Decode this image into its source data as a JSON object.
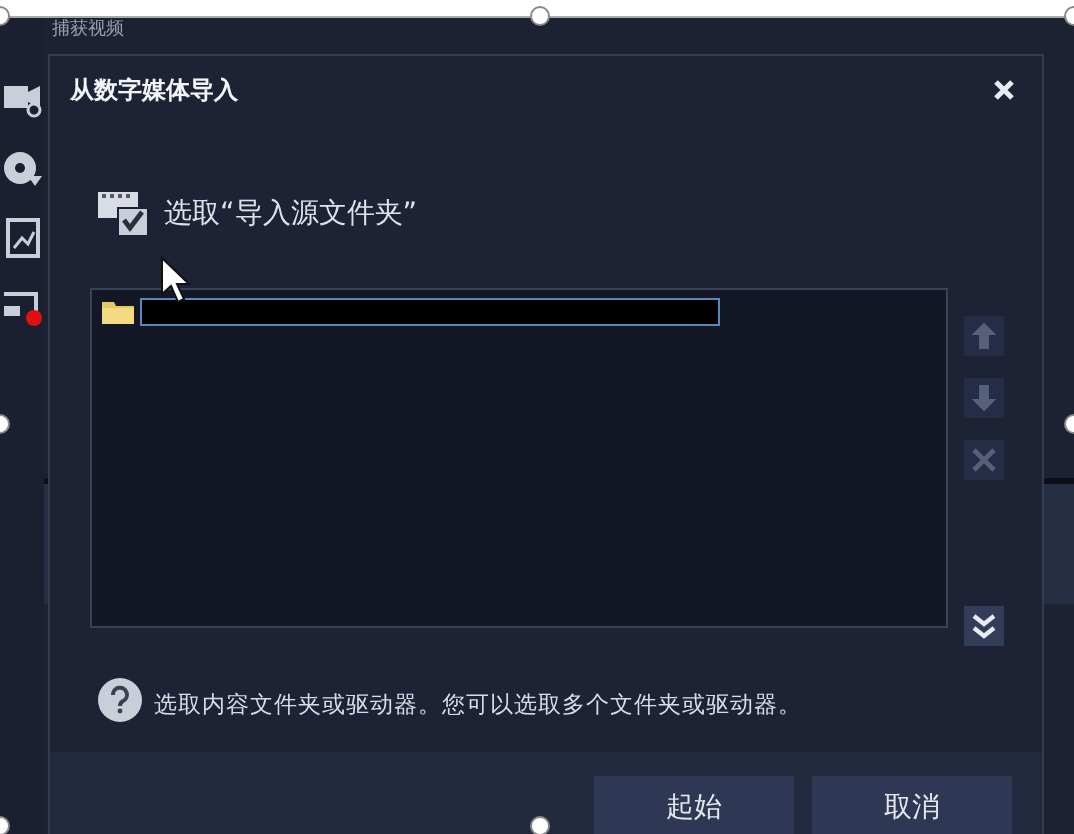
{
  "app": {
    "caption": "捕获视频"
  },
  "dialog": {
    "title": "从数字媒体导入",
    "heading": "选取“导入源文件夹”",
    "folders": [
      {
        "kind": "redacted",
        "selected": true
      }
    ],
    "side_buttons": [
      {
        "kind": "up",
        "disabled": true
      },
      {
        "kind": "down",
        "disabled": true
      },
      {
        "kind": "remove",
        "disabled": true
      },
      {
        "kind": "expand",
        "disabled": false
      }
    ],
    "help_text": "选取内容文件夹或驱动器。您可以选取多个文件夹或驱动器。",
    "buttons": [
      "起始",
      "取消"
    ]
  }
}
